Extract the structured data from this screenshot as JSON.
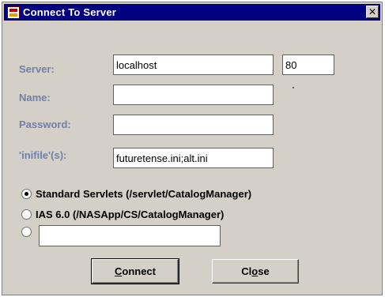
{
  "window": {
    "title": "Connect To Server",
    "close_glyph": "✕"
  },
  "form": {
    "server_label": "Server:",
    "server_value": "localhost",
    "port_value": "80",
    "name_label": "Name:",
    "name_value": "",
    "password_label": "Password:",
    "password_value": "",
    "inifile_label": "'inifile'(s):",
    "inifile_value": "futuretense.ini;alt.ini"
  },
  "options": [
    {
      "label": "Standard Servlets  (/servlet/CatalogManager)",
      "selected": true
    },
    {
      "label": "IAS 6.0  (/NASApp/CS/CatalogManager)",
      "selected": false
    },
    {
      "label": "",
      "selected": false,
      "custom_value": ""
    }
  ],
  "buttons": {
    "connect": {
      "mnemonic": "C",
      "rest": "onnect"
    },
    "close": {
      "pre": "Cl",
      "mnemonic": "o",
      "rest": "se"
    }
  },
  "colors": {
    "titlebar": "#000080",
    "label_text": "#7080a8",
    "dialog_bg": "#d4d0c8"
  }
}
